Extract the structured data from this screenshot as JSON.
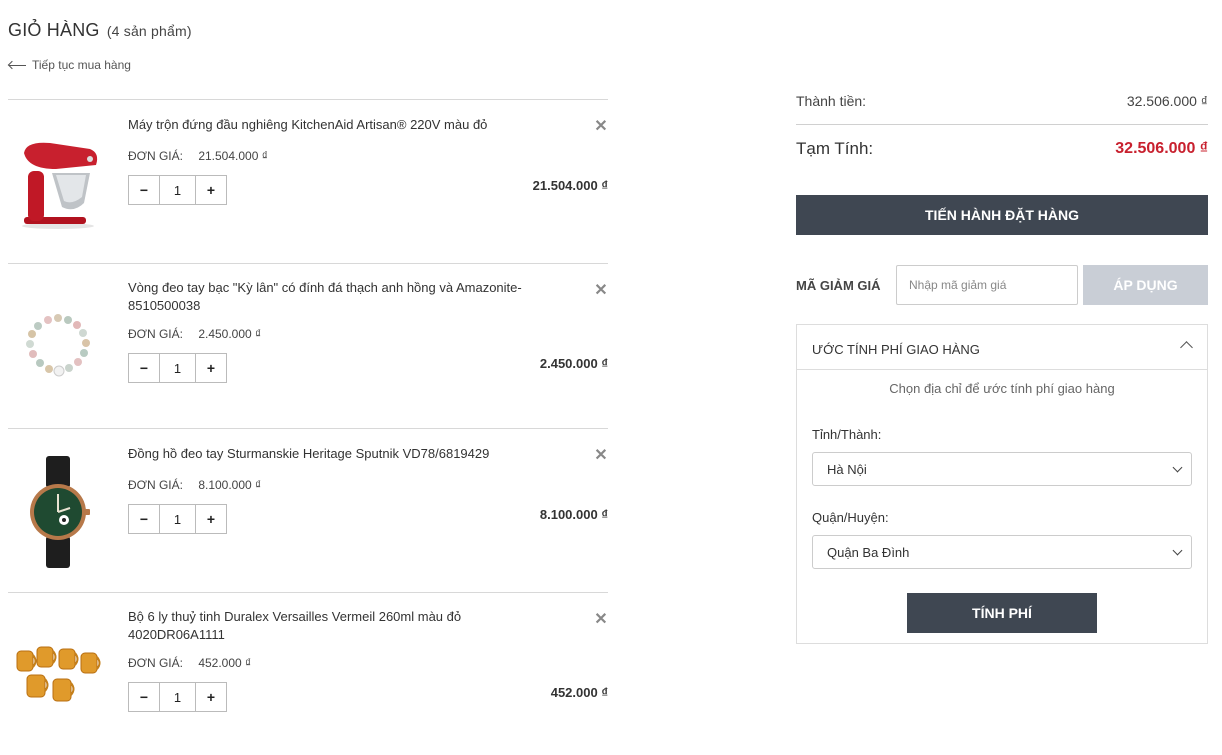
{
  "header": {
    "title": "GIỎ HÀNG",
    "count": "(4 sản phẩm)",
    "continue_link": "Tiếp tục mua hàng"
  },
  "cart": {
    "unit_price_label": "ĐƠN GIÁ:",
    "items": [
      {
        "name": "Máy trộn đứng đầu nghiêng KitchenAid Artisan® 220V màu đỏ",
        "unit_price": "21.504.000 ₫",
        "quantity": "1",
        "line_total": "21.504.000 ₫",
        "icon": "stand-mixer-image"
      },
      {
        "name": "Vòng đeo tay bạc \"Kỳ lân\" có đính đá thạch anh hồng và Amazonite-8510500038",
        "unit_price": "2.450.000 ₫",
        "quantity": "1",
        "line_total": "2.450.000 ₫",
        "icon": "bracelet-image"
      },
      {
        "name": "Đồng hồ đeo tay Sturmanskie Heritage Sputnik VD78/6819429",
        "unit_price": "8.100.000 ₫",
        "quantity": "1",
        "line_total": "8.100.000 ₫",
        "icon": "watch-image"
      },
      {
        "name": "Bộ 6 ly thuỷ tinh Duralex Versailles Vermeil 260ml màu đỏ 4020DR06A1111",
        "unit_price": "452.000 ₫",
        "quantity": "1",
        "line_total": "452.000 ₫",
        "icon": "glasses-image"
      }
    ],
    "minus": "−",
    "plus": "+",
    "remove": "✕"
  },
  "summary": {
    "subtotal_label": "Thành tiền:",
    "subtotal_value": "32.506.000 ₫",
    "total_label": "Tạm Tính:",
    "total_value": "32.506.000 ₫",
    "checkout_label": "TIẾN HÀNH ĐẶT HÀNG",
    "coupon_label": "MÃ GIẢM GIÁ",
    "coupon_placeholder": "Nhập mã giảm giá",
    "apply_label": "ÁP DỤNG"
  },
  "shipping": {
    "title": "ƯỚC TÍNH PHÍ GIAO HÀNG",
    "hint": "Chọn địa chỉ để ước tính phí giao hàng",
    "province_label": "Tỉnh/Thành:",
    "province_value": "Hà Nội",
    "district_label": "Quận/Huyện:",
    "district_value": "Quận Ba Đình",
    "calc_label": "TÍNH PHÍ"
  },
  "colors": {
    "accent_dark": "#3f4752",
    "total_red": "#c8202e",
    "disabled_button": "#c9ced6"
  }
}
